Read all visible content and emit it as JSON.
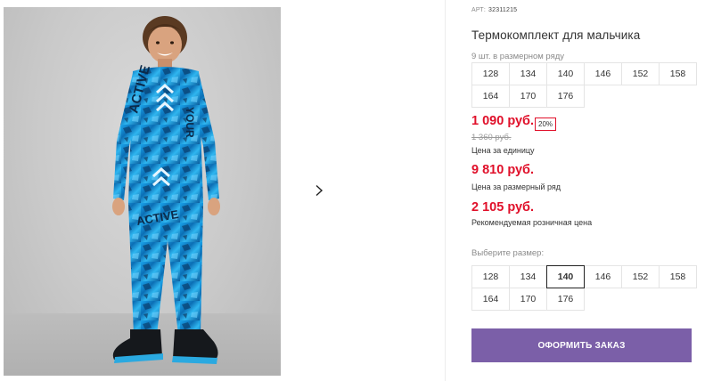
{
  "product": {
    "article_label": "АРТ:",
    "article_value": "32311215",
    "title": "Термокомплект для мальчика"
  },
  "series": {
    "note": "9 шт. в размерном ряду",
    "sizes": [
      "128",
      "134",
      "140",
      "146",
      "152",
      "158",
      "164",
      "170",
      "176"
    ]
  },
  "pricing": {
    "price_current": "1 090 руб.",
    "discount_badge": "20%",
    "price_old": "1 360 руб.",
    "unit_label": "Цена за единицу",
    "series_price": "9 810 руб.",
    "series_label": "Цена за размерный ряд",
    "rrp_price": "2 105 руб.",
    "rrp_label": "Рекомендуемая розничная цена"
  },
  "size_select": {
    "label": "Выберите размер:",
    "sizes": [
      "128",
      "134",
      "140",
      "146",
      "152",
      "158",
      "164",
      "170",
      "176"
    ],
    "selected": "140"
  },
  "actions": {
    "order_button": "ОФОРМИТЬ ЗАКАЗ"
  },
  "gallery": {
    "next_icon": "chevron-right-icon",
    "garment_print": [
      "ACTIVE",
      "YOUR",
      "ACTIVE"
    ]
  },
  "colors": {
    "price_red": "#e0102a",
    "button_purple": "#7b5fa8",
    "garment_blue": "#1f8fd6"
  }
}
